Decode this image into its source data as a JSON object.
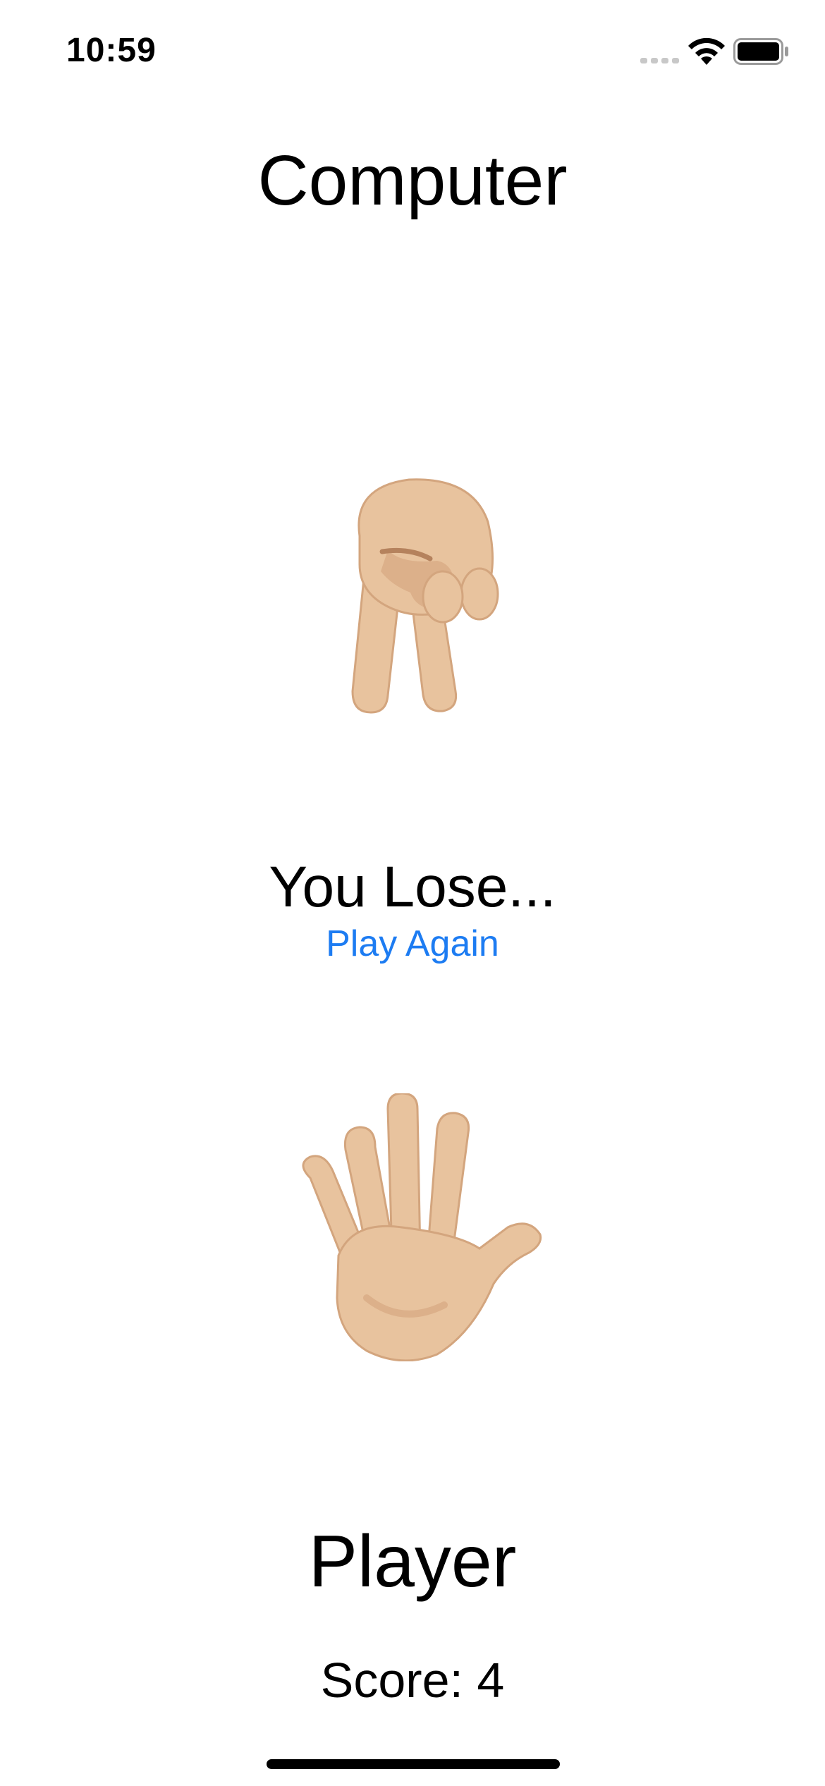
{
  "status_bar": {
    "time": "10:59"
  },
  "computer": {
    "title": "Computer",
    "hand_icon": "fingers-crossed-downward-icon"
  },
  "result": {
    "text": "You Lose...",
    "play_again_label": "Play Again"
  },
  "player": {
    "title": "Player",
    "hand_icon": "raised-open-hand-icon",
    "score": "Score: 4"
  },
  "colors": {
    "accent": "#1d7cf2",
    "skin": "#e8c39e",
    "skin_shadow": "#c99a70"
  }
}
